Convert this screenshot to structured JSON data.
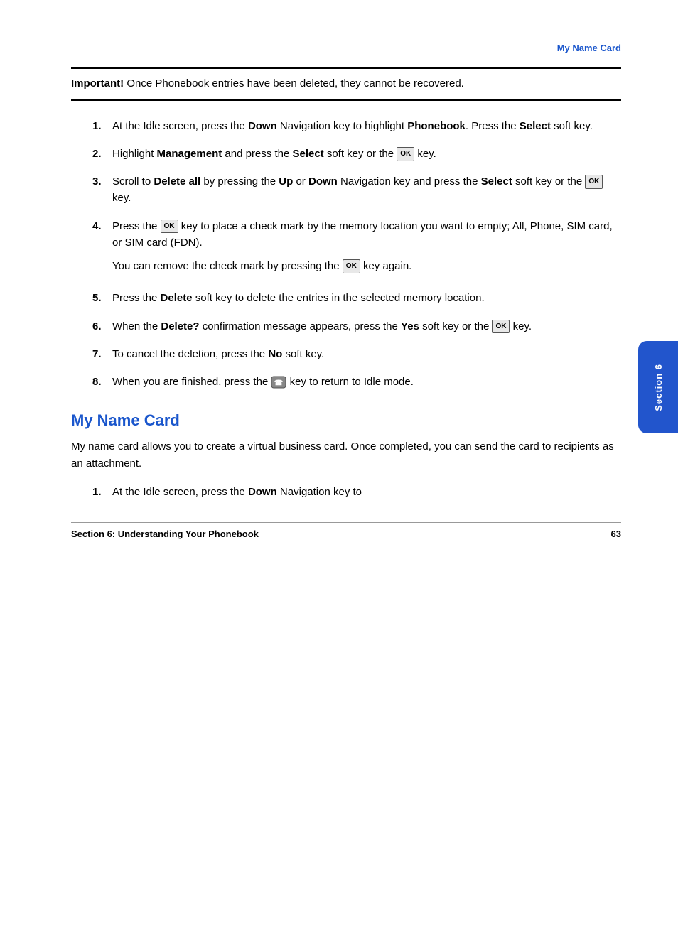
{
  "header": {
    "title": "My Name Card"
  },
  "important_box": {
    "label": "Important!",
    "text": " Once Phonebook entries have been deleted, they cannot be recovered."
  },
  "steps": [
    {
      "number": "1.",
      "text_parts": [
        {
          "text": "At the Idle screen, press the ",
          "bold": false
        },
        {
          "text": "Down",
          "bold": true
        },
        {
          "text": " Navigation key to highlight ",
          "bold": false
        },
        {
          "text": "Phonebook",
          "bold": true
        },
        {
          "text": ". Press the ",
          "bold": false
        },
        {
          "text": "Select",
          "bold": true
        },
        {
          "text": " soft key.",
          "bold": false
        }
      ]
    },
    {
      "number": "2.",
      "text_parts": [
        {
          "text": "Highlight ",
          "bold": false
        },
        {
          "text": "Management",
          "bold": true
        },
        {
          "text": " and press the ",
          "bold": false
        },
        {
          "text": "Select",
          "bold": true
        },
        {
          "text": " soft key or the ",
          "bold": false
        },
        {
          "text": "OK_KEY",
          "bold": false
        },
        {
          "text": " key.",
          "bold": false
        }
      ]
    },
    {
      "number": "3.",
      "text_parts": [
        {
          "text": "Scroll to ",
          "bold": false
        },
        {
          "text": "Delete all",
          "bold": true
        },
        {
          "text": " by pressing the ",
          "bold": false
        },
        {
          "text": "Up",
          "bold": true
        },
        {
          "text": " or ",
          "bold": false
        },
        {
          "text": "Down",
          "bold": true
        },
        {
          "text": " Navigation key and press the ",
          "bold": false
        },
        {
          "text": "Select",
          "bold": true
        },
        {
          "text": " soft key or the ",
          "bold": false
        },
        {
          "text": "OK_KEY",
          "bold": false
        },
        {
          "text": " key.",
          "bold": false
        }
      ]
    },
    {
      "number": "4.",
      "text_parts": [
        {
          "text": "Press the ",
          "bold": false
        },
        {
          "text": "OK_KEY",
          "bold": false
        },
        {
          "text": " key to place a check mark by the memory location you want to empty; All, Phone, SIM card, or SIM card (FDN).",
          "bold": false
        }
      ],
      "sub_paragraph": "You can remove the check mark by pressing the OK_KEY key again."
    },
    {
      "number": "5.",
      "text_parts": [
        {
          "text": "Press the ",
          "bold": false
        },
        {
          "text": "Delete",
          "bold": true
        },
        {
          "text": " soft key to delete the entries in the selected memory location.",
          "bold": false
        }
      ]
    },
    {
      "number": "6.",
      "text_parts": [
        {
          "text": "When the ",
          "bold": false
        },
        {
          "text": "Delete?",
          "bold": true
        },
        {
          "text": " confirmation message appears, press the ",
          "bold": false
        },
        {
          "text": "Yes",
          "bold": true
        },
        {
          "text": " soft key or the ",
          "bold": false
        },
        {
          "text": "OK_KEY",
          "bold": false
        },
        {
          "text": " key.",
          "bold": false
        }
      ]
    },
    {
      "number": "7.",
      "text_parts": [
        {
          "text": "To cancel the deletion, press the ",
          "bold": false
        },
        {
          "text": "No",
          "bold": true
        },
        {
          "text": " soft key.",
          "bold": false
        }
      ]
    },
    {
      "number": "8.",
      "text_parts": [
        {
          "text": "When you are finished, press the ",
          "bold": false
        },
        {
          "text": "END_KEY",
          "bold": false
        },
        {
          "text": " key to return to Idle mode.",
          "bold": false
        }
      ]
    }
  ],
  "my_name_card": {
    "heading": "My Name Card",
    "intro": "My name card allows you to create a virtual business card. Once completed, you can send the card to recipients as an attachment.",
    "step1_start": "At the Idle screen, press the ",
    "step1_bold": "Down",
    "step1_end": " Navigation key to"
  },
  "section_tab": {
    "text": "Section 6"
  },
  "footer": {
    "label": "Section 6: Understanding Your Phonebook",
    "page": "63"
  }
}
